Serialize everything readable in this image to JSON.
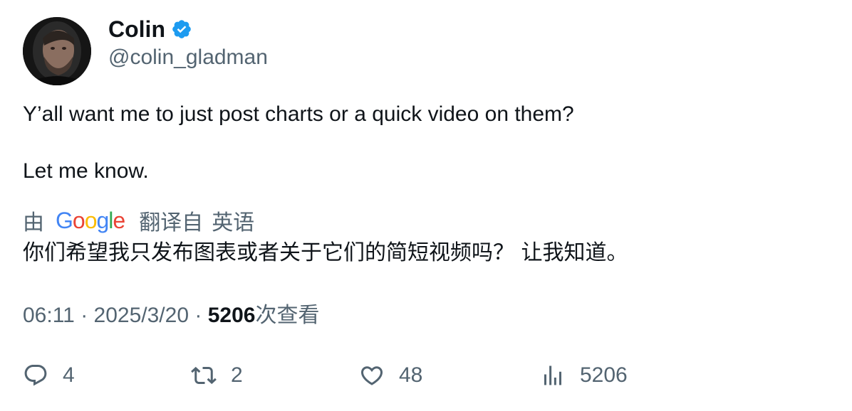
{
  "author": {
    "name": "Colin",
    "handle": "@colin_gladman",
    "avatar": "avatar-photo",
    "verified_icon": "verified-badge-icon"
  },
  "tweet": {
    "line1": "Y’all want me to just post charts or a quick video on them?",
    "line2": "Let me know."
  },
  "translation": {
    "by": "由",
    "provider": "Google",
    "translated_from": "翻译自",
    "language": "英语",
    "text": "你们希望我只发布图表或者关于它们的简短视频吗？ 让我知道。"
  },
  "meta": {
    "time": "06:11",
    "separator": "·",
    "date": "2025/3/20",
    "views": "5206",
    "views_label": "次查看"
  },
  "actions": {
    "replies": "4",
    "retweets": "2",
    "likes": "48",
    "views": "5206"
  },
  "colors": {
    "verified": "#1d9bf0",
    "secondary_text": "#536471",
    "primary_text": "#0f1419"
  }
}
